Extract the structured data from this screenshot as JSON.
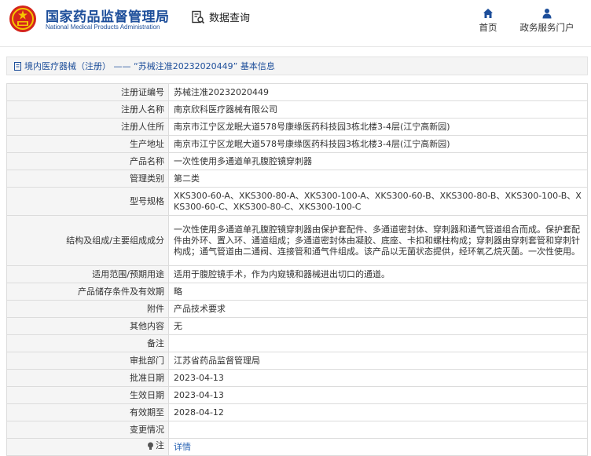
{
  "header": {
    "brand_cn": "国家药品监督管理局",
    "brand_en": "National Medical Products Administration",
    "query_label": "数据查询",
    "nav": [
      {
        "label": "首页",
        "icon": "home-icon"
      },
      {
        "label": "政务服务门户",
        "icon": "person-icon"
      }
    ],
    "brand_color": "#1d4e9a",
    "emblem_color": "#d4251c"
  },
  "breadcrumb": {
    "text": "境内医疗器械（注册） —— “苏械注准20232020449” 基本信息"
  },
  "rows": [
    {
      "label": "注册证编号",
      "value": "苏械注准20232020449"
    },
    {
      "label": "注册人名称",
      "value": "南京欣科医疗器械有限公司"
    },
    {
      "label": "注册人住所",
      "value": "南京市江宁区龙眠大道578号康缘医药科技园3栋北楼3-4层(江宁高新园)"
    },
    {
      "label": "生产地址",
      "value": "南京市江宁区龙眠大道578号康缘医药科技园3栋北楼3-4层(江宁高新园)"
    },
    {
      "label": "产品名称",
      "value": "一次性使用多通道单孔腹腔镜穿刺器"
    },
    {
      "label": "管理类别",
      "value": "第二类"
    },
    {
      "label": "型号规格",
      "value": "XKS300-60-A、XKS300-80-A、XKS300-100-A、XKS300-60-B、XKS300-80-B、XKS300-100-B、XKS300-60-C、XKS300-80-C、XKS300-100-C"
    },
    {
      "label": "结构及组成/主要组成成分",
      "value": "一次性使用多通道单孔腹腔镜穿刺器由保护套配件、多通道密封体、穿刺器和通气管道组合而成。保护套配件由外环、置入环、通道组成；多通道密封体由凝胶、底座、卡扣和螺柱构成；穿刺器由穿刺套管和穿刺针构成；通气管道由二通阀、连接管和通气件组成。该产品以无菌状态提供，经环氧乙烷灭菌。一次性使用。"
    },
    {
      "label": "适用范围/预期用途",
      "value": "适用于腹腔镜手术，作为内窥镜和器械进出切口的通道。"
    },
    {
      "label": "产品储存条件及有效期",
      "value": "略"
    },
    {
      "label": "附件",
      "value": "产品技术要求"
    },
    {
      "label": "其他内容",
      "value": "无"
    },
    {
      "label": "备注",
      "value": ""
    },
    {
      "label": "审批部门",
      "value": "江苏省药品监督管理局"
    },
    {
      "label": "批准日期",
      "value": "2023-04-13"
    },
    {
      "label": "生效日期",
      "value": "2023-04-13"
    },
    {
      "label": "有效期至",
      "value": "2028-04-12"
    },
    {
      "label": "变更情况",
      "value": ""
    }
  ],
  "note_row": {
    "label": "注",
    "icon": "lightbulb-icon",
    "link": "详情"
  }
}
